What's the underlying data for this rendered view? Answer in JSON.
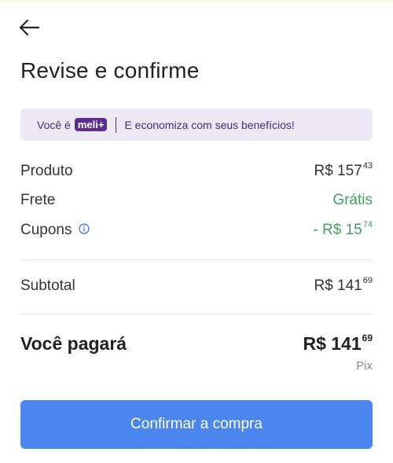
{
  "header": {
    "title": "Revise e confirme"
  },
  "banner": {
    "prefix": "Você é",
    "badge": "meli+",
    "message": "E economiza com seus benefícios!"
  },
  "summary": {
    "produto": {
      "label": "Produto",
      "currency": "R$",
      "int": "157",
      "cents": "43"
    },
    "frete": {
      "label": "Frete",
      "value": "Grátis"
    },
    "cupons": {
      "label": "Cupons",
      "sign": "-",
      "currency": "R$",
      "int": "15",
      "cents": "74"
    },
    "subtotal": {
      "label": "Subtotal",
      "currency": "R$",
      "int": "141",
      "cents": "69"
    }
  },
  "total": {
    "label": "Você pagará",
    "currency": "R$",
    "int": "141",
    "cents": "69",
    "method": "Pix"
  },
  "actions": {
    "confirm_label": "Confirmar a compra"
  },
  "colors": {
    "primary": "#4a86ee",
    "success": "#3fa35f",
    "meli_purple": "#5c2d91",
    "banner_bg": "#ece8f4"
  }
}
